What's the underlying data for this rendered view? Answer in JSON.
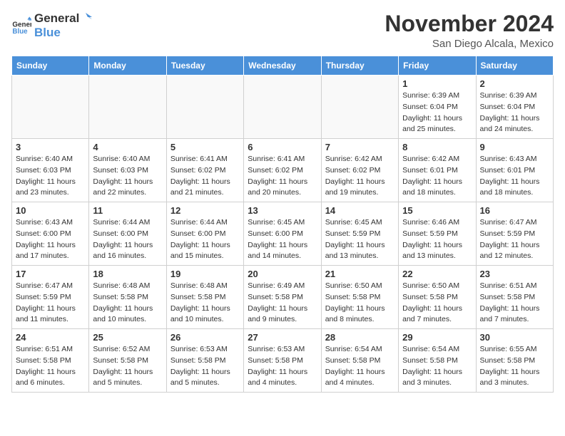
{
  "logo": {
    "text_general": "General",
    "text_blue": "Blue"
  },
  "header": {
    "month_year": "November 2024",
    "location": "San Diego Alcala, Mexico"
  },
  "weekdays": [
    "Sunday",
    "Monday",
    "Tuesday",
    "Wednesday",
    "Thursday",
    "Friday",
    "Saturday"
  ],
  "weeks": [
    [
      {
        "day": "",
        "info": ""
      },
      {
        "day": "",
        "info": ""
      },
      {
        "day": "",
        "info": ""
      },
      {
        "day": "",
        "info": ""
      },
      {
        "day": "",
        "info": ""
      },
      {
        "day": "1",
        "info": "Sunrise: 6:39 AM\nSunset: 6:04 PM\nDaylight: 11 hours and 25 minutes."
      },
      {
        "day": "2",
        "info": "Sunrise: 6:39 AM\nSunset: 6:04 PM\nDaylight: 11 hours and 24 minutes."
      }
    ],
    [
      {
        "day": "3",
        "info": "Sunrise: 6:40 AM\nSunset: 6:03 PM\nDaylight: 11 hours and 23 minutes."
      },
      {
        "day": "4",
        "info": "Sunrise: 6:40 AM\nSunset: 6:03 PM\nDaylight: 11 hours and 22 minutes."
      },
      {
        "day": "5",
        "info": "Sunrise: 6:41 AM\nSunset: 6:02 PM\nDaylight: 11 hours and 21 minutes."
      },
      {
        "day": "6",
        "info": "Sunrise: 6:41 AM\nSunset: 6:02 PM\nDaylight: 11 hours and 20 minutes."
      },
      {
        "day": "7",
        "info": "Sunrise: 6:42 AM\nSunset: 6:02 PM\nDaylight: 11 hours and 19 minutes."
      },
      {
        "day": "8",
        "info": "Sunrise: 6:42 AM\nSunset: 6:01 PM\nDaylight: 11 hours and 18 minutes."
      },
      {
        "day": "9",
        "info": "Sunrise: 6:43 AM\nSunset: 6:01 PM\nDaylight: 11 hours and 18 minutes."
      }
    ],
    [
      {
        "day": "10",
        "info": "Sunrise: 6:43 AM\nSunset: 6:00 PM\nDaylight: 11 hours and 17 minutes."
      },
      {
        "day": "11",
        "info": "Sunrise: 6:44 AM\nSunset: 6:00 PM\nDaylight: 11 hours and 16 minutes."
      },
      {
        "day": "12",
        "info": "Sunrise: 6:44 AM\nSunset: 6:00 PM\nDaylight: 11 hours and 15 minutes."
      },
      {
        "day": "13",
        "info": "Sunrise: 6:45 AM\nSunset: 6:00 PM\nDaylight: 11 hours and 14 minutes."
      },
      {
        "day": "14",
        "info": "Sunrise: 6:45 AM\nSunset: 5:59 PM\nDaylight: 11 hours and 13 minutes."
      },
      {
        "day": "15",
        "info": "Sunrise: 6:46 AM\nSunset: 5:59 PM\nDaylight: 11 hours and 13 minutes."
      },
      {
        "day": "16",
        "info": "Sunrise: 6:47 AM\nSunset: 5:59 PM\nDaylight: 11 hours and 12 minutes."
      }
    ],
    [
      {
        "day": "17",
        "info": "Sunrise: 6:47 AM\nSunset: 5:59 PM\nDaylight: 11 hours and 11 minutes."
      },
      {
        "day": "18",
        "info": "Sunrise: 6:48 AM\nSunset: 5:58 PM\nDaylight: 11 hours and 10 minutes."
      },
      {
        "day": "19",
        "info": "Sunrise: 6:48 AM\nSunset: 5:58 PM\nDaylight: 11 hours and 10 minutes."
      },
      {
        "day": "20",
        "info": "Sunrise: 6:49 AM\nSunset: 5:58 PM\nDaylight: 11 hours and 9 minutes."
      },
      {
        "day": "21",
        "info": "Sunrise: 6:50 AM\nSunset: 5:58 PM\nDaylight: 11 hours and 8 minutes."
      },
      {
        "day": "22",
        "info": "Sunrise: 6:50 AM\nSunset: 5:58 PM\nDaylight: 11 hours and 7 minutes."
      },
      {
        "day": "23",
        "info": "Sunrise: 6:51 AM\nSunset: 5:58 PM\nDaylight: 11 hours and 7 minutes."
      }
    ],
    [
      {
        "day": "24",
        "info": "Sunrise: 6:51 AM\nSunset: 5:58 PM\nDaylight: 11 hours and 6 minutes."
      },
      {
        "day": "25",
        "info": "Sunrise: 6:52 AM\nSunset: 5:58 PM\nDaylight: 11 hours and 5 minutes."
      },
      {
        "day": "26",
        "info": "Sunrise: 6:53 AM\nSunset: 5:58 PM\nDaylight: 11 hours and 5 minutes."
      },
      {
        "day": "27",
        "info": "Sunrise: 6:53 AM\nSunset: 5:58 PM\nDaylight: 11 hours and 4 minutes."
      },
      {
        "day": "28",
        "info": "Sunrise: 6:54 AM\nSunset: 5:58 PM\nDaylight: 11 hours and 4 minutes."
      },
      {
        "day": "29",
        "info": "Sunrise: 6:54 AM\nSunset: 5:58 PM\nDaylight: 11 hours and 3 minutes."
      },
      {
        "day": "30",
        "info": "Sunrise: 6:55 AM\nSunset: 5:58 PM\nDaylight: 11 hours and 3 minutes."
      }
    ]
  ]
}
